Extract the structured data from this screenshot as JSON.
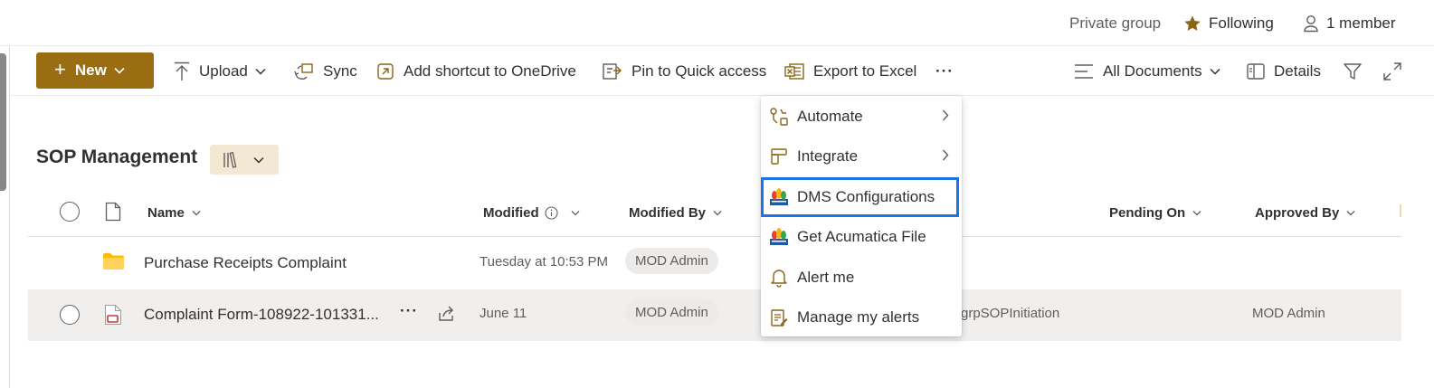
{
  "topbar": {
    "privacy": "Private group",
    "following": "Following",
    "members": "1 member"
  },
  "commandbar": {
    "new_label": "New",
    "upload_label": "Upload",
    "sync_label": "Sync",
    "shortcut_label": "Add shortcut to OneDrive",
    "pin_label": "Pin to Quick access",
    "export_label": "Export to Excel",
    "more_label": "···",
    "view_label": "All Documents",
    "details_label": "Details"
  },
  "library": {
    "title": "SOP Management"
  },
  "columns": {
    "name": "Name",
    "modified": "Modified",
    "modified_by": "Modified By",
    "pending_on": "Pending On",
    "approved_by": "Approved By"
  },
  "rows": [
    {
      "name": "Purchase Receipts Complaint",
      "modified": "Tuesday at 10:53 PM",
      "modified_by": "MOD Admin",
      "extra": "",
      "approved_by": ""
    },
    {
      "name": "Complaint Form-108922-101331...",
      "modified": "June 11",
      "modified_by": "MOD Admin",
      "extra": "grpSOPInitiation",
      "approved_by": "MOD Admin"
    }
  ],
  "menu": {
    "items": [
      {
        "label": "Automate",
        "icon": "automate-icon",
        "submenu": true
      },
      {
        "label": "Integrate",
        "icon": "integrate-icon",
        "submenu": true
      },
      {
        "label": "DMS Configurations",
        "icon": "dms-logo-icon",
        "submenu": false
      },
      {
        "label": "Get Acumatica File",
        "icon": "dms-logo-icon",
        "submenu": false
      },
      {
        "label": "Alert me",
        "icon": "bell-icon",
        "submenu": false
      },
      {
        "label": "Manage my alerts",
        "icon": "manage-alerts-icon",
        "submenu": false
      }
    ]
  },
  "colors": {
    "brand": "#9a6d12",
    "highlight": "#1a73e8",
    "folder": "#ffb900"
  }
}
